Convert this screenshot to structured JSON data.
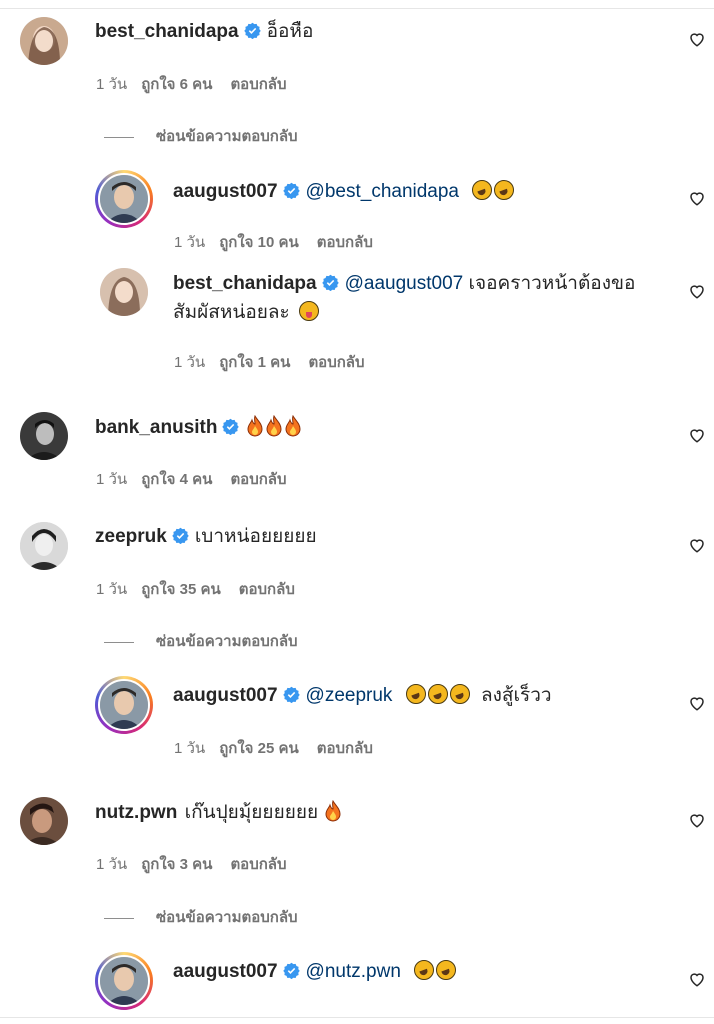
{
  "comments": [
    {
      "username": "best_chanidapa",
      "text": "อ็อหือ",
      "time": "1 วัน",
      "likes": "ถูกใจ 6 คน",
      "reply_label": "ตอบกลับ",
      "hide_replies": "ซ่อนข้อความตอบกลับ",
      "icons": [
        "verified-badge-icon",
        "heart-icon"
      ]
    },
    {
      "username": "aaugust007",
      "mention": "@best_chanidapa",
      "emojis": [
        "rolling-laughing-emoji",
        "rolling-laughing-emoji"
      ],
      "time": "1 วัน",
      "likes": "ถูกใจ 10 คน",
      "reply_label": "ตอบกลับ"
    },
    {
      "username": "best_chanidapa",
      "mention": "@aaugust007",
      "text": "เจอคราวหน้าต้องขอ",
      "text_line2": "สัมผัสหน่อยละ",
      "emojis": [
        "winking-tongue-emoji"
      ],
      "time": "1 วัน",
      "likes": "ถูกใจ 1 คน",
      "reply_label": "ตอบกลับ"
    },
    {
      "username": "bank_anusith",
      "emojis": [
        "fire-emoji",
        "fire-emoji",
        "fire-emoji"
      ],
      "time": "1 วัน",
      "likes": "ถูกใจ 4 คน",
      "reply_label": "ตอบกลับ"
    },
    {
      "username": "zeepruk",
      "text": "เบาหน่อยยยยย",
      "time": "1 วัน",
      "likes": "ถูกใจ 35 คน",
      "reply_label": "ตอบกลับ",
      "hide_replies": "ซ่อนข้อความตอบกลับ"
    },
    {
      "username": "aaugust007",
      "mention": "@zeepruk",
      "emojis": [
        "rolling-laughing-emoji",
        "rolling-laughing-emoji",
        "rolling-laughing-emoji"
      ],
      "text": "ลงสู้เร็วว",
      "time": "1 วัน",
      "likes": "ถูกใจ 25 คน",
      "reply_label": "ตอบกลับ"
    },
    {
      "username": "nutz.pwn",
      "text": "เก๊นปุยมุ้ยยยยยย",
      "emojis": [
        "fire-emoji"
      ],
      "time": "1 วัน",
      "likes": "ถูกใจ 3 คน",
      "reply_label": "ตอบกลับ",
      "hide_replies": "ซ่อนข้อความตอบกลับ"
    },
    {
      "username": "aaugust007",
      "mention": "@nutz.pwn",
      "emojis": [
        "rolling-laughing-emoji",
        "rolling-laughing-emoji"
      ]
    }
  ],
  "colors": {
    "verified": "#3897f0",
    "mention": "#00376b",
    "meta": "#737373"
  }
}
